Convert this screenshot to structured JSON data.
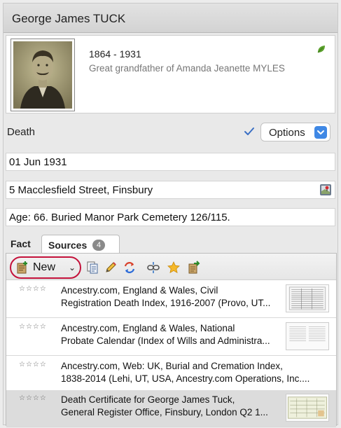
{
  "person": {
    "name": "George James TUCK",
    "years": "1864 - 1931",
    "relation": "Great grandfather of Amanda Jeanette MYLES"
  },
  "fact": {
    "label": "Death",
    "options_label": "Options",
    "date": "01 Jun 1931",
    "place": "5 Macclesfield Street, Finsbury",
    "description": "Age: 66.  Buried Manor Park Cemetery 126/115."
  },
  "tabs": {
    "fact": "Fact",
    "sources": "Sources",
    "sources_count": "4"
  },
  "toolbar": {
    "new_label": "New",
    "chevron": "⌄"
  },
  "icons": {
    "leaf": "leaf-icon",
    "check": "checkmark-icon",
    "map": "map-pin-icon",
    "new": "add-source-icon",
    "copy": "copy-icon",
    "edit": "pencil-icon",
    "replace": "replace-icon",
    "link": "link-icon",
    "favorite": "star-icon",
    "export": "export-icon"
  },
  "sources": [
    {
      "stars": "☆☆☆☆",
      "line1": "Ancestry.com, England & Wales, Civil",
      "line2": "Registration Death Index, 1916-2007 (Provo, UT..."
    },
    {
      "stars": "☆☆☆☆",
      "line1": "Ancestry.com, England & Wales, National",
      "line2": "Probate Calendar (Index of Wills and Administra..."
    },
    {
      "stars": "☆☆☆☆",
      "line1": "Ancestry.com, Web: UK, Burial and Cremation Index,",
      "line2": "1838-2014 (Lehi, UT, USA, Ancestry.com Operations, Inc...."
    },
    {
      "stars": "☆☆☆☆",
      "line1": "Death Certificate for George James Tuck,",
      "line2": "General Register Office, Finsbury, London Q2 1..."
    }
  ],
  "colors": {
    "accent_blue": "#3f88e5",
    "highlight_ring": "#c4123b",
    "leaf_green": "#5aa02c"
  }
}
